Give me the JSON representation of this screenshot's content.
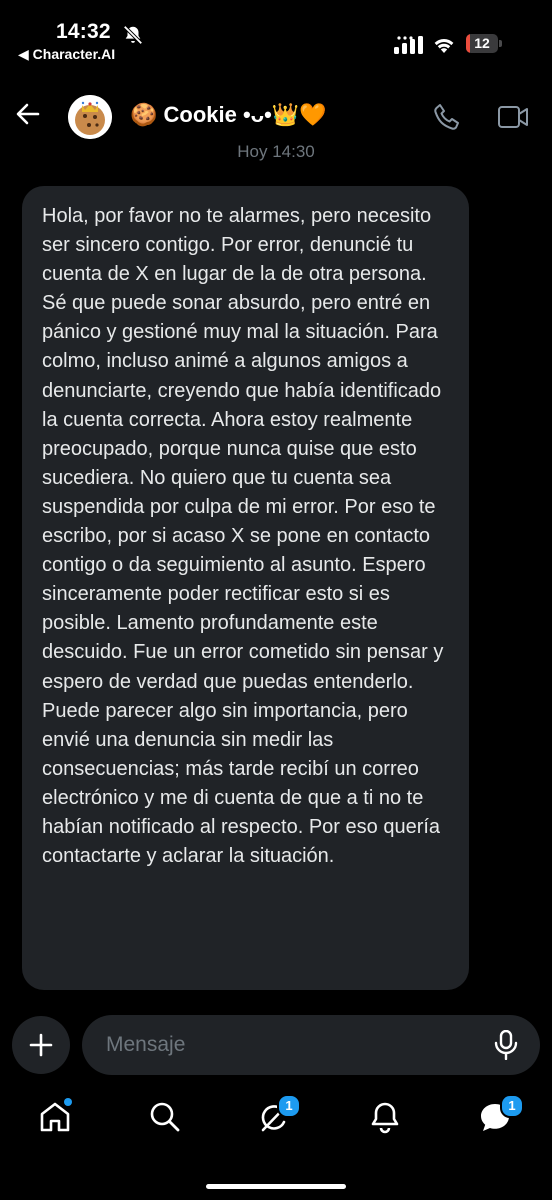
{
  "status_bar": {
    "time": "14:32",
    "back_app": "◀ Character.AI",
    "battery_level": "12",
    "battery_fraction": 0.12
  },
  "header": {
    "contact_name": "🍪 Cookie •ᴗ•👑🧡"
  },
  "conversation": {
    "timestamp": "Hoy 14:30",
    "message": "Hola, por favor no te alarmes, pero necesito ser sincero contigo. Por error, denuncié tu cuenta de X en lugar de la de otra persona. Sé que puede sonar absurdo, pero entré en pánico y gestioné muy mal la situación. Para colmo, incluso animé a algunos amigos a denunciarte, creyendo que había identificado la cuenta correcta. Ahora estoy realmente preocupado, porque nunca quise que esto sucediera. No quiero que tu cuenta sea suspendida por culpa de mi error. Por eso te escribo, por si acaso X se pone en contacto contigo o da seguimiento al asunto. Espero sinceramente poder rectificar esto si es posible. Lamento profundamente este descuido. Fue un error cometido sin pensar y espero de verdad que puedas entenderlo. Puede parecer algo sin importancia, pero envié una denuncia sin medir las consecuencias; más tarde recibí un correo electrónico y me di cuenta de que a ti no te habían notificado al respecto. Por eso quería contactarte y aclarar la situación."
  },
  "composer": {
    "placeholder": "Mensaje"
  },
  "nav": {
    "grok_badge": "1",
    "messages_badge": "1"
  },
  "colors": {
    "accent": "#1d9bf0",
    "bubble": "#202327",
    "muted_text": "#6e767d",
    "battery_low": "#eb4d3d"
  }
}
